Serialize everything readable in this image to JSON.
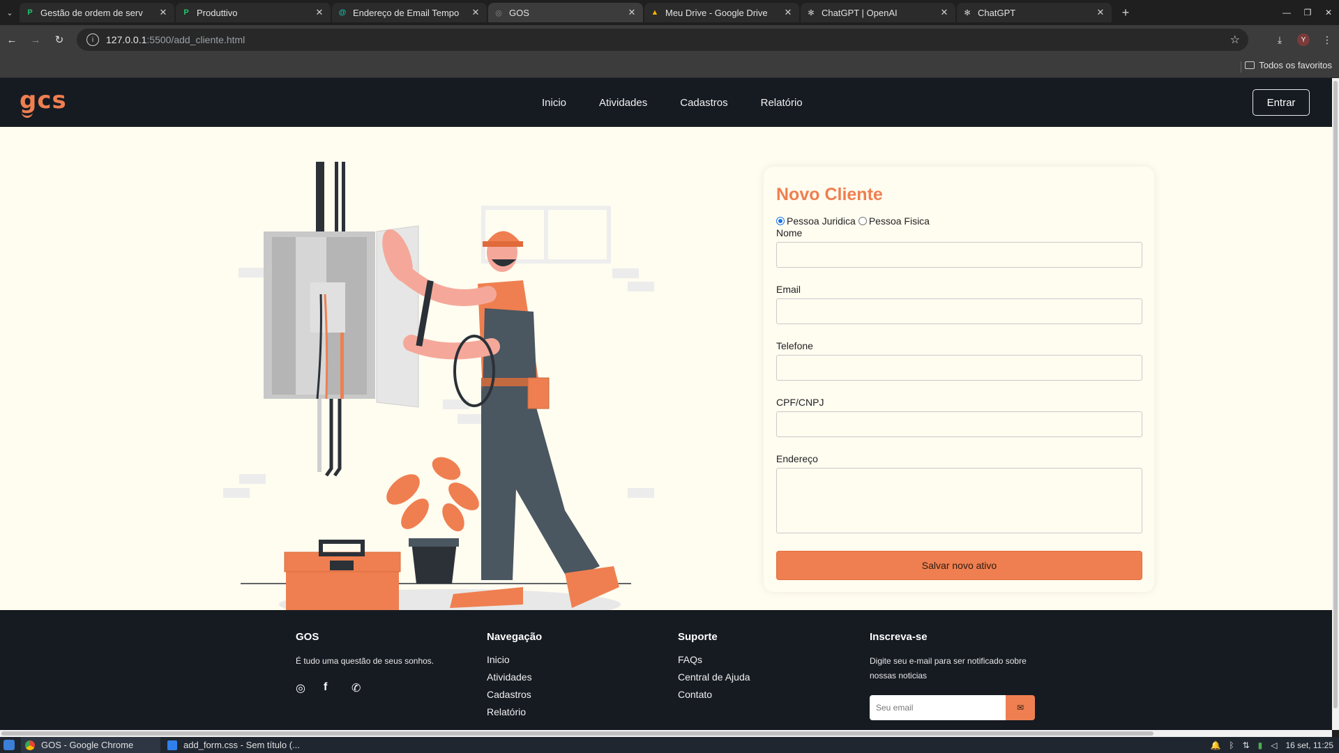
{
  "browser": {
    "tabs": [
      {
        "title": "Gestão de ordem de serv",
        "favicon": "P",
        "favicon_color": "#1ec96b"
      },
      {
        "title": "Produttivo",
        "favicon": "P",
        "favicon_color": "#1ec96b"
      },
      {
        "title": "Endereço de Email Tempo",
        "favicon": "@",
        "favicon_color": "#14b8a6"
      },
      {
        "title": "GOS",
        "favicon": "◎",
        "favicon_color": "#8a8a8a"
      },
      {
        "title": "Meu Drive - Google Drive",
        "favicon": "▲",
        "favicon_color": "#f4b400"
      },
      {
        "title": "ChatGPT | OpenAI",
        "favicon": "✻",
        "favicon_color": "#d0d0d0"
      },
      {
        "title": "ChatGPT",
        "favicon": "✻",
        "favicon_color": "#d0d0d0"
      }
    ],
    "url_host": "127.0.0.1",
    "url_rest": ":5500/add_cliente.html",
    "profile_initial": "Y",
    "bookmarks_all": "Todos os favoritos"
  },
  "site": {
    "logo": "gcs",
    "nav": [
      "Inicio",
      "Atividades",
      "Cadastros",
      "Relatório"
    ],
    "login": "Entrar"
  },
  "form": {
    "title": "Novo Cliente",
    "radio_juridica": "Pessoa Juridica",
    "radio_fisica": "Pessoa Fisica",
    "selected": "Pessoa Juridica",
    "labels": {
      "nome": "Nome",
      "email": "Email",
      "telefone": "Telefone",
      "cpf": "CPF/CNPJ",
      "endereco": "Endereço"
    },
    "submit": "Salvar novo ativo"
  },
  "footer": {
    "brand": "GOS",
    "tagline": "É tudo uma questão de seus sonhos.",
    "nav_title": "Navegação",
    "nav_links": [
      "Inicio",
      "Atividades",
      "Cadastros",
      "Relatório"
    ],
    "support_title": "Suporte",
    "support_links": [
      "FAQs",
      "Central de Ajuda",
      "Contato"
    ],
    "subscribe_title": "Inscreva-se",
    "subscribe_text": "Digite seu e-mail para ser notificado sobre nossas noticias",
    "subscribe_placeholder": "Seu email",
    "socials": [
      "instagram-icon",
      "facebook-icon",
      "whatsapp-icon"
    ]
  },
  "taskbar": {
    "tasks": [
      "GOS - Google Chrome",
      "add_form.css - Sem título (..."
    ],
    "clock": "16 set, 11:25"
  },
  "colors": {
    "accent": "#ef7f50",
    "header_bg": "#161b22",
    "page_bg": "#fffcf0"
  }
}
